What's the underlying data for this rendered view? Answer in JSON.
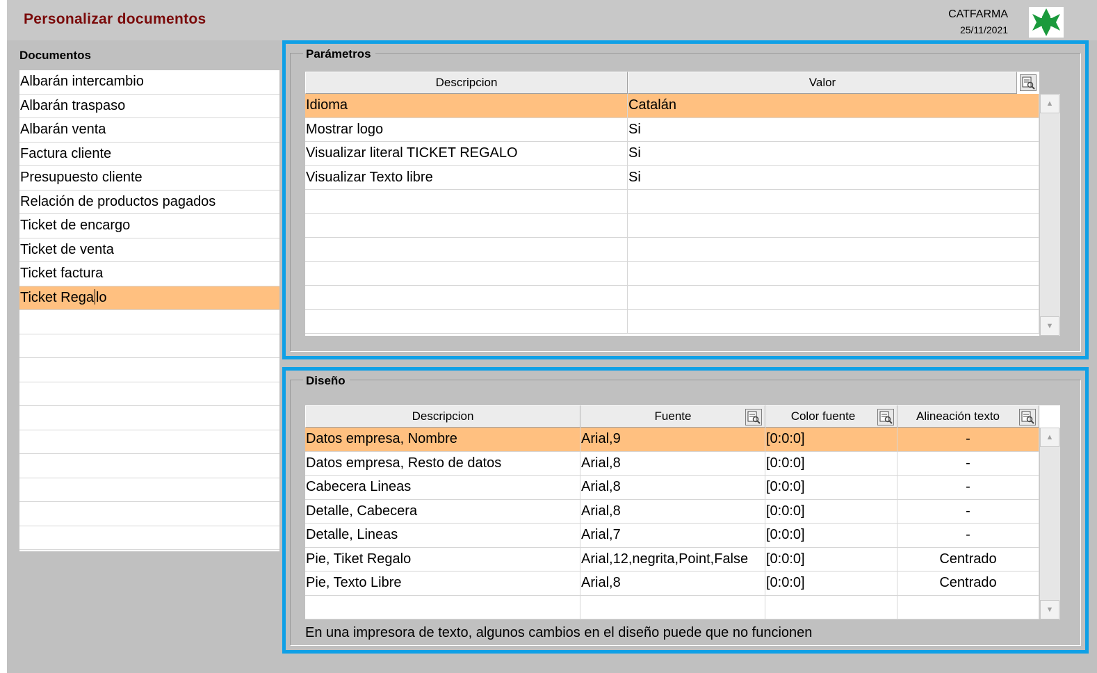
{
  "header": {
    "title": "Personalizar documentos",
    "company": "CATFARMA",
    "date": "25/11/2021",
    "logo_icon": "green-cross-icon"
  },
  "documents": {
    "header": "Documentos",
    "items": [
      "Albarán intercambio",
      "Albarán traspaso",
      "Albarán venta",
      "Factura cliente",
      "Presupuesto cliente",
      "Relación de productos pagados",
      "Ticket de encargo",
      "Ticket de venta",
      "Ticket factura",
      "Ticket Regalo"
    ],
    "selected_index": 9
  },
  "parametros": {
    "title": "Parámetros",
    "columns": [
      "Descripcion",
      "Valor"
    ],
    "rows": [
      [
        "Idioma",
        "Catalán"
      ],
      [
        "Mostrar logo",
        "Si"
      ],
      [
        "Visualizar literal TICKET REGALO",
        "Si"
      ],
      [
        "Visualizar Texto libre",
        "Si"
      ]
    ],
    "selected_index": 0
  },
  "diseno": {
    "title": "Diseño",
    "columns": [
      "Descripcion",
      "Fuente",
      "Color fuente",
      "Alineación texto"
    ],
    "rows": [
      [
        "Datos empresa, Nombre",
        "Arial,9",
        "[0:0:0]",
        "-"
      ],
      [
        "Datos empresa, Resto de datos",
        "Arial,8",
        "[0:0:0]",
        "-"
      ],
      [
        "Cabecera Lineas",
        "Arial,8",
        "[0:0:0]",
        "-"
      ],
      [
        "Detalle, Cabecera",
        "Arial,8",
        "[0:0:0]",
        "-"
      ],
      [
        "Detalle, Lineas",
        "Arial,7",
        "[0:0:0]",
        "-"
      ],
      [
        "Pie, Tiket Regalo",
        "Arial,12,negrita,Point,False",
        "[0:0:0]",
        "Centrado"
      ],
      [
        "Pie, Texto Libre",
        "Arial,8",
        "[0:0:0]",
        "Centrado"
      ]
    ],
    "selected_index": 0,
    "note": "En una impresora de texto, algunos cambios en el diseño puede que no funcionen"
  },
  "colors": {
    "selection": "#ffc080",
    "highlight_border": "#0fa0e6",
    "title": "#7a0a0a",
    "background": "#c0c0c0"
  }
}
